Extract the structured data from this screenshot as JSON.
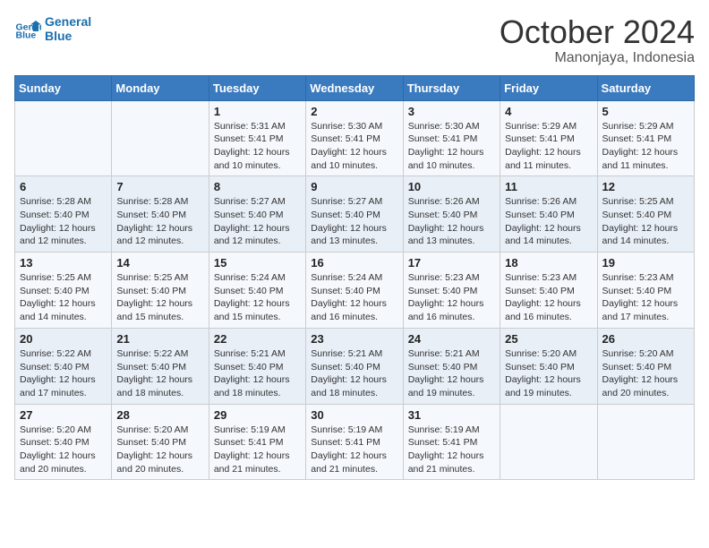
{
  "header": {
    "logo_line1": "General",
    "logo_line2": "Blue",
    "title": "October 2024",
    "subtitle": "Manonjaya, Indonesia"
  },
  "calendar": {
    "days_of_week": [
      "Sunday",
      "Monday",
      "Tuesday",
      "Wednesday",
      "Thursday",
      "Friday",
      "Saturday"
    ],
    "weeks": [
      [
        {
          "day": "",
          "details": ""
        },
        {
          "day": "",
          "details": ""
        },
        {
          "day": "1",
          "details": "Sunrise: 5:31 AM\nSunset: 5:41 PM\nDaylight: 12 hours and 10 minutes."
        },
        {
          "day": "2",
          "details": "Sunrise: 5:30 AM\nSunset: 5:41 PM\nDaylight: 12 hours and 10 minutes."
        },
        {
          "day": "3",
          "details": "Sunrise: 5:30 AM\nSunset: 5:41 PM\nDaylight: 12 hours and 10 minutes."
        },
        {
          "day": "4",
          "details": "Sunrise: 5:29 AM\nSunset: 5:41 PM\nDaylight: 12 hours and 11 minutes."
        },
        {
          "day": "5",
          "details": "Sunrise: 5:29 AM\nSunset: 5:41 PM\nDaylight: 12 hours and 11 minutes."
        }
      ],
      [
        {
          "day": "6",
          "details": "Sunrise: 5:28 AM\nSunset: 5:40 PM\nDaylight: 12 hours and 12 minutes."
        },
        {
          "day": "7",
          "details": "Sunrise: 5:28 AM\nSunset: 5:40 PM\nDaylight: 12 hours and 12 minutes."
        },
        {
          "day": "8",
          "details": "Sunrise: 5:27 AM\nSunset: 5:40 PM\nDaylight: 12 hours and 12 minutes."
        },
        {
          "day": "9",
          "details": "Sunrise: 5:27 AM\nSunset: 5:40 PM\nDaylight: 12 hours and 13 minutes."
        },
        {
          "day": "10",
          "details": "Sunrise: 5:26 AM\nSunset: 5:40 PM\nDaylight: 12 hours and 13 minutes."
        },
        {
          "day": "11",
          "details": "Sunrise: 5:26 AM\nSunset: 5:40 PM\nDaylight: 12 hours and 14 minutes."
        },
        {
          "day": "12",
          "details": "Sunrise: 5:25 AM\nSunset: 5:40 PM\nDaylight: 12 hours and 14 minutes."
        }
      ],
      [
        {
          "day": "13",
          "details": "Sunrise: 5:25 AM\nSunset: 5:40 PM\nDaylight: 12 hours and 14 minutes."
        },
        {
          "day": "14",
          "details": "Sunrise: 5:25 AM\nSunset: 5:40 PM\nDaylight: 12 hours and 15 minutes."
        },
        {
          "day": "15",
          "details": "Sunrise: 5:24 AM\nSunset: 5:40 PM\nDaylight: 12 hours and 15 minutes."
        },
        {
          "day": "16",
          "details": "Sunrise: 5:24 AM\nSunset: 5:40 PM\nDaylight: 12 hours and 16 minutes."
        },
        {
          "day": "17",
          "details": "Sunrise: 5:23 AM\nSunset: 5:40 PM\nDaylight: 12 hours and 16 minutes."
        },
        {
          "day": "18",
          "details": "Sunrise: 5:23 AM\nSunset: 5:40 PM\nDaylight: 12 hours and 16 minutes."
        },
        {
          "day": "19",
          "details": "Sunrise: 5:23 AM\nSunset: 5:40 PM\nDaylight: 12 hours and 17 minutes."
        }
      ],
      [
        {
          "day": "20",
          "details": "Sunrise: 5:22 AM\nSunset: 5:40 PM\nDaylight: 12 hours and 17 minutes."
        },
        {
          "day": "21",
          "details": "Sunrise: 5:22 AM\nSunset: 5:40 PM\nDaylight: 12 hours and 18 minutes."
        },
        {
          "day": "22",
          "details": "Sunrise: 5:21 AM\nSunset: 5:40 PM\nDaylight: 12 hours and 18 minutes."
        },
        {
          "day": "23",
          "details": "Sunrise: 5:21 AM\nSunset: 5:40 PM\nDaylight: 12 hours and 18 minutes."
        },
        {
          "day": "24",
          "details": "Sunrise: 5:21 AM\nSunset: 5:40 PM\nDaylight: 12 hours and 19 minutes."
        },
        {
          "day": "25",
          "details": "Sunrise: 5:20 AM\nSunset: 5:40 PM\nDaylight: 12 hours and 19 minutes."
        },
        {
          "day": "26",
          "details": "Sunrise: 5:20 AM\nSunset: 5:40 PM\nDaylight: 12 hours and 20 minutes."
        }
      ],
      [
        {
          "day": "27",
          "details": "Sunrise: 5:20 AM\nSunset: 5:40 PM\nDaylight: 12 hours and 20 minutes."
        },
        {
          "day": "28",
          "details": "Sunrise: 5:20 AM\nSunset: 5:40 PM\nDaylight: 12 hours and 20 minutes."
        },
        {
          "day": "29",
          "details": "Sunrise: 5:19 AM\nSunset: 5:41 PM\nDaylight: 12 hours and 21 minutes."
        },
        {
          "day": "30",
          "details": "Sunrise: 5:19 AM\nSunset: 5:41 PM\nDaylight: 12 hours and 21 minutes."
        },
        {
          "day": "31",
          "details": "Sunrise: 5:19 AM\nSunset: 5:41 PM\nDaylight: 12 hours and 21 minutes."
        },
        {
          "day": "",
          "details": ""
        },
        {
          "day": "",
          "details": ""
        }
      ]
    ]
  }
}
